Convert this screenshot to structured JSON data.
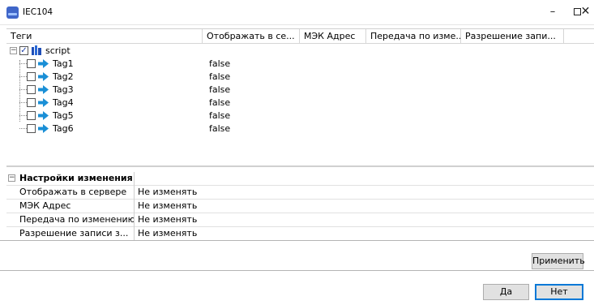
{
  "window": {
    "title": "IEC104",
    "minimize": "–",
    "close": "✕"
  },
  "tree": {
    "columns": [
      "Теги",
      "Отображать в се...",
      "МЭК Адрес",
      "Передача по изме...",
      "Разрешение запи..."
    ],
    "root": {
      "label": "script",
      "checked": true,
      "expander": "−"
    },
    "rows": [
      {
        "label": "Tag1",
        "show_in_server": "false"
      },
      {
        "label": "Tag2",
        "show_in_server": "false"
      },
      {
        "label": "Tag3",
        "show_in_server": "false"
      },
      {
        "label": "Tag4",
        "show_in_server": "false"
      },
      {
        "label": "Tag5",
        "show_in_server": "false"
      },
      {
        "label": "Tag6",
        "show_in_server": "false"
      }
    ]
  },
  "properties": {
    "category": "Настройки изменения",
    "expander": "−",
    "items": [
      {
        "name": "Отображать в сервере",
        "value": "Не изменять"
      },
      {
        "name": "МЭК Адрес",
        "value": "Не изменять"
      },
      {
        "name": "Передача по изменению",
        "value": "Не изменять"
      },
      {
        "name": "Разрешение записи з...",
        "value": "Не изменять"
      }
    ]
  },
  "buttons": {
    "apply": "Применить",
    "yes": "Да",
    "no": "Нет"
  },
  "colors": {
    "accent": "#0078d7",
    "arrow": "#1a8fd6",
    "app_icon": "#3f66c9"
  }
}
